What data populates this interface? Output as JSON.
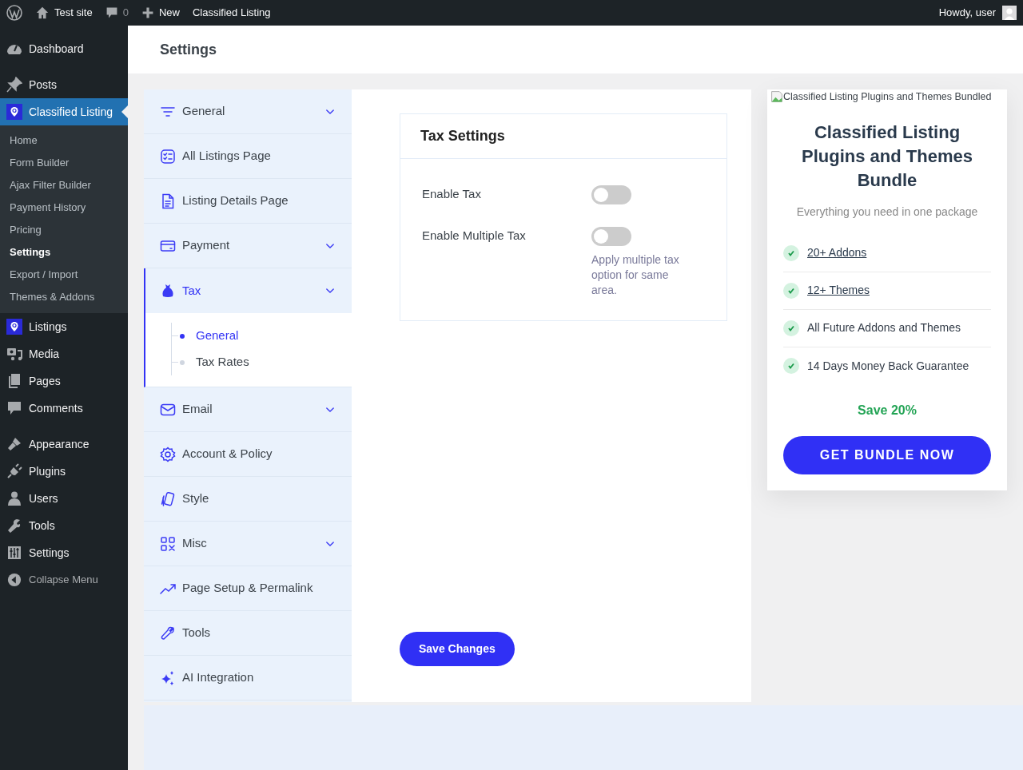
{
  "admin_bar": {
    "site": "Test site",
    "comments": "0",
    "new": "New",
    "plugin": "Classified Listing",
    "greeting": "Howdy, user"
  },
  "menu": {
    "groups": [
      [
        {
          "label": "Dashboard",
          "selected": false
        }
      ],
      [
        {
          "label": "Posts",
          "selected": false
        },
        {
          "label": "Classified Listing",
          "selected": true,
          "submenu": [
            {
              "label": "Home",
              "selected": false
            },
            {
              "label": "Form Builder",
              "selected": false
            },
            {
              "label": "Ajax Filter Builder",
              "selected": false
            },
            {
              "label": "Payment History",
              "selected": false
            },
            {
              "label": "Pricing",
              "selected": false
            },
            {
              "label": "Settings",
              "selected": true
            },
            {
              "label": "Export / Import",
              "selected": false
            },
            {
              "label": "Themes & Addons",
              "selected": false
            }
          ]
        },
        {
          "label": "Listings",
          "selected": false
        },
        {
          "label": "Media",
          "selected": false
        },
        {
          "label": "Pages",
          "selected": false
        },
        {
          "label": "Comments",
          "selected": false
        }
      ],
      [
        {
          "label": "Appearance",
          "selected": false
        },
        {
          "label": "Plugins",
          "selected": false
        },
        {
          "label": "Users",
          "selected": false
        },
        {
          "label": "Tools",
          "selected": false
        },
        {
          "label": "Settings",
          "selected": false
        }
      ]
    ],
    "collapse": "Collapse Menu"
  },
  "page_title": "Settings",
  "settings_nav": [
    {
      "label": "General",
      "expandable": true,
      "expanded": false,
      "selected": false
    },
    {
      "label": "All Listings Page",
      "expandable": false,
      "expanded": false,
      "selected": false
    },
    {
      "label": "Listing Details Page",
      "expandable": false,
      "expanded": false,
      "selected": false
    },
    {
      "label": "Payment",
      "expandable": true,
      "expanded": false,
      "selected": false
    },
    {
      "label": "Tax",
      "expandable": true,
      "expanded": true,
      "selected": true,
      "children": [
        {
          "label": "General",
          "selected": true
        },
        {
          "label": "Tax Rates",
          "selected": false
        }
      ]
    },
    {
      "label": "Email",
      "expandable": true,
      "expanded": false,
      "selected": false
    },
    {
      "label": "Account & Policy",
      "expandable": false,
      "expanded": false,
      "selected": false
    },
    {
      "label": "Style",
      "expandable": false,
      "expanded": false,
      "selected": false
    },
    {
      "label": "Misc",
      "expandable": true,
      "expanded": false,
      "selected": false
    },
    {
      "label": "Page Setup & Permalink",
      "expandable": false,
      "expanded": false,
      "selected": false
    },
    {
      "label": "Tools",
      "expandable": false,
      "expanded": false,
      "selected": false
    },
    {
      "label": "AI Integration",
      "expandable": false,
      "expanded": false,
      "selected": false
    }
  ],
  "tax_settings": {
    "title": "Tax Settings",
    "fields": [
      {
        "label": "Enable Tax",
        "on": false
      },
      {
        "label": "Enable Multiple Tax",
        "on": false,
        "description": "Apply multiple tax option for same area."
      }
    ]
  },
  "save_button": "Save Changes",
  "promo": {
    "image_alt": "Classified Listing Plugins and Themes Bundled",
    "title": "Classified Listing Plugins and Themes Bundle",
    "subtitle": "Everything you need in one package",
    "features": [
      {
        "text": "20+ Addons",
        "link": true
      },
      {
        "text": "12+ Themes",
        "link": true
      },
      {
        "text": "All Future Addons and Themes",
        "link": false
      },
      {
        "text": "14 Days Money Back Guarantee",
        "link": false
      }
    ],
    "save": "Save 20%",
    "button": "GET BUNDLE NOW"
  }
}
